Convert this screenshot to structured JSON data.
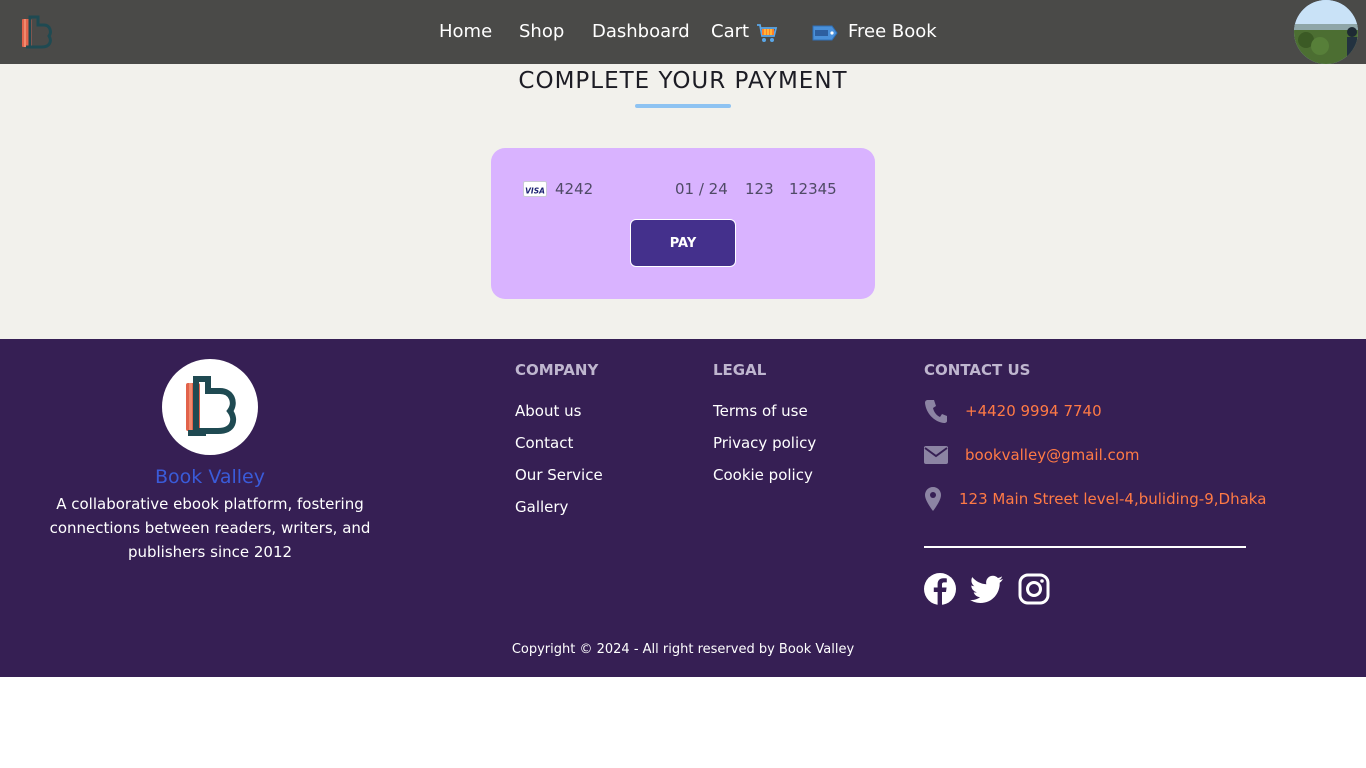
{
  "nav": {
    "logo_icon": "book-valley-logo-icon",
    "links": [
      {
        "label": "Home"
      },
      {
        "label": "Shop"
      },
      {
        "label": "Dashboard"
      },
      {
        "label": "Cart"
      },
      {
        "label": "Free Book"
      }
    ],
    "cart_icon": "cart-icon",
    "free_icon": "free-badge-icon",
    "avatar_icon": "user-avatar"
  },
  "main": {
    "title": "COMPLETE YOUR PAYMENT",
    "card": {
      "brand": "VISA",
      "number": "4242",
      "expiry": "01 / 24",
      "cvc": "123",
      "zip": "12345"
    },
    "pay_label": "PAY"
  },
  "footer": {
    "brand_name": "Book Valley",
    "description": "A collaborative ebook platform, fostering connections between readers, writers, and publishers since 2012",
    "company": {
      "heading": "COMPANY",
      "links": [
        "About us",
        "Contact",
        "Our Service",
        "Gallery"
      ]
    },
    "legal": {
      "heading": "LEGAL",
      "links": [
        "Terms of use",
        "Privacy policy",
        "Cookie policy"
      ]
    },
    "contact": {
      "heading": "CONTACT US",
      "phone": "+4420 9994 7740",
      "email": "bookvalley@gmail.com",
      "address": "123 Main Street level-4,buliding-9,Dhaka"
    },
    "socials": [
      "facebook-icon",
      "twitter-icon",
      "instagram-icon"
    ],
    "copyright": "Copyright © 2024 - All right reserved by Book Valley"
  },
  "colors": {
    "navbar": "#4a4a48",
    "page_bg": "#f2f1ec",
    "card_bg": "#d9b3ff",
    "pay_button": "#44308c",
    "footer_bg": "#361f54",
    "brand_name": "#3a5bd9",
    "contact_text": "#ff7a45",
    "title_underline": "#8ec3f2"
  }
}
